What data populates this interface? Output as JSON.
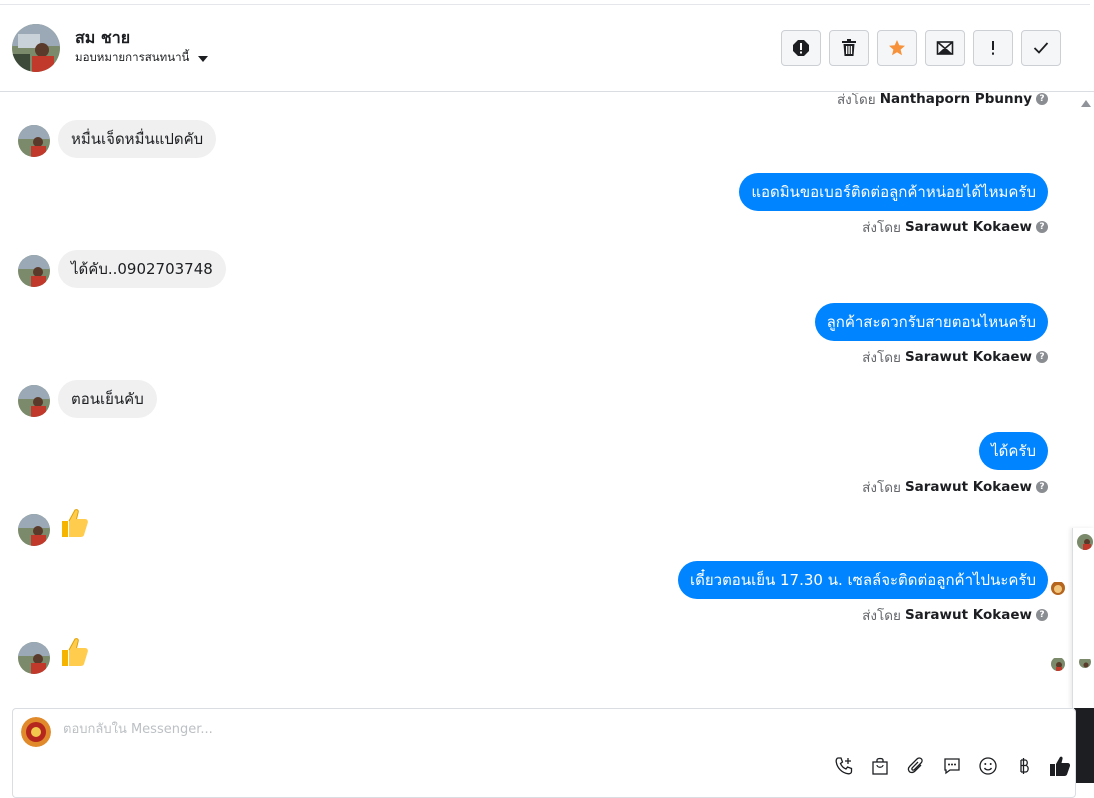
{
  "header": {
    "contact_name": "สม ชาย",
    "assign_label": "มอบหมายการสนทนานี้"
  },
  "actions": [
    {
      "name": "spam-button",
      "icon": "alert-octagon-icon"
    },
    {
      "name": "delete-button",
      "icon": "trash-icon"
    },
    {
      "name": "star-button",
      "icon": "star-icon",
      "color": "#f7923b"
    },
    {
      "name": "mark-unread-button",
      "icon": "envelope-icon"
    },
    {
      "name": "follow-up-button",
      "icon": "exclamation-icon"
    },
    {
      "name": "done-button",
      "icon": "check-icon"
    }
  ],
  "chat": {
    "top_sent_by": {
      "prefix": "ส่งโดย",
      "name": "Nanthaporn Pbunny"
    },
    "messages": [
      {
        "dir": "in",
        "text": "หมื่นเจ็ดหมื่นแปดคับ"
      },
      {
        "dir": "out",
        "text": "แอดมินขอเบอร์ติดต่อลูกค้าหน่อยได้ไหมครับ",
        "sent_prefix": "ส่งโดย",
        "sent_by": "Sarawut Kokaew"
      },
      {
        "dir": "in",
        "text": "ได้คับ..0902703748"
      },
      {
        "dir": "out",
        "text": "ลูกค้าสะดวกรับสายตอนไหนครับ",
        "sent_prefix": "ส่งโดย",
        "sent_by": "Sarawut Kokaew"
      },
      {
        "dir": "in",
        "text": "ตอนเย็นคับ"
      },
      {
        "dir": "out",
        "text": "ได้ครับ",
        "sent_prefix": "ส่งโดย",
        "sent_by": "Sarawut Kokaew"
      },
      {
        "dir": "in",
        "sticker": "thumbs-up-icon"
      },
      {
        "dir": "out",
        "text": "เดี๋ยวตอนเย็น 17.30 น. เซลล์จะติดต่อลูกค้าไปนะครับ",
        "sent_prefix": "ส่งโดย",
        "sent_by": "Sarawut Kokaew"
      },
      {
        "dir": "in",
        "sticker": "thumbs-up-icon"
      }
    ]
  },
  "composer": {
    "placeholder": "ตอบกลับใน Messenger...",
    "value": ""
  },
  "tools": [
    "call-add-icon",
    "shopping-bag-icon",
    "paperclip-icon",
    "saved-reply-icon",
    "emoji-icon",
    "baht-icon",
    "like-icon"
  ],
  "colors": {
    "accent": "#0084ff",
    "incoming_bubble": "#f0f0f0",
    "star": "#f7923b"
  }
}
